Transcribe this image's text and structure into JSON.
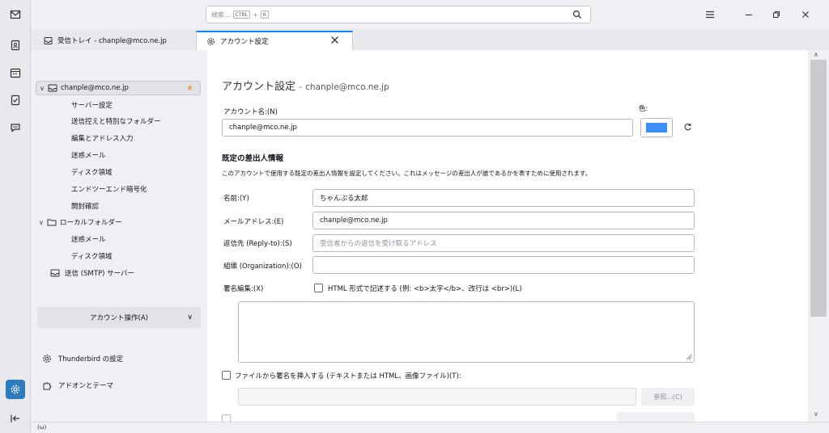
{
  "toolbar": {
    "search_placeholder": "検索...",
    "kbd_ctrl": "CTRL",
    "kbd_plus": "+",
    "kbd_k": "K"
  },
  "tabs": [
    {
      "label": "受信トレイ - chanple@mco.ne.jp"
    },
    {
      "label": "アカウント設定"
    }
  ],
  "folder_pane": {
    "account": "chanple@mco.ne.jp",
    "account_items": [
      "サーバー設定",
      "送信控えと特別なフォルダー",
      "編集とアドレス入力",
      "迷惑メール",
      "ディスク領域",
      "エンドツーエンド暗号化",
      "開封確認"
    ],
    "local_folders": "ローカルフォルダー",
    "local_items": [
      "迷惑メール",
      "ディスク領域"
    ],
    "smtp": "送信 (SMTP) サーバー",
    "account_actions": "アカウント操作(A)",
    "thunderbird_settings": "Thunderbird の設定",
    "addons": "アドオンとテーマ"
  },
  "content": {
    "title": "アカウント設定",
    "title_sep": "-",
    "title_account": "chanple@mco.ne.jp",
    "account_name_label": "アカウント名:(N)",
    "account_name_value": "chanple@mco.ne.jp",
    "color_label": "色:",
    "color_value": "#3c8ff6",
    "identity_title": "既定の差出人情報",
    "identity_desc": "このアカウントで使用する既定の差出人情報を設定してください。これはメッセージの差出人が誰であるかを表すために使用されます。",
    "name_label": "名前:(Y)",
    "name_value": "ちゃんぷる太郎",
    "email_label": "メールアドレス:(E)",
    "email_value": "chanple@mco.ne.jp",
    "replyto_label": "返信先 (Reply-to):(S)",
    "replyto_placeholder": "受信者からの返信を受け取るアドレス",
    "org_label": "組織 (Organization):(O)",
    "org_value": "",
    "sig_label": "署名編集:(X)",
    "sig_html_label": "HTML 形式で記述する (例: <b>太字</b>、改行は <br>)(L)",
    "sig_file_label": "ファイルから署名を挿入する (テキストまたは HTML、画像ファイル)(T):",
    "browse_label": "参照...(C)"
  },
  "status": {
    "icon": "(ω)"
  }
}
